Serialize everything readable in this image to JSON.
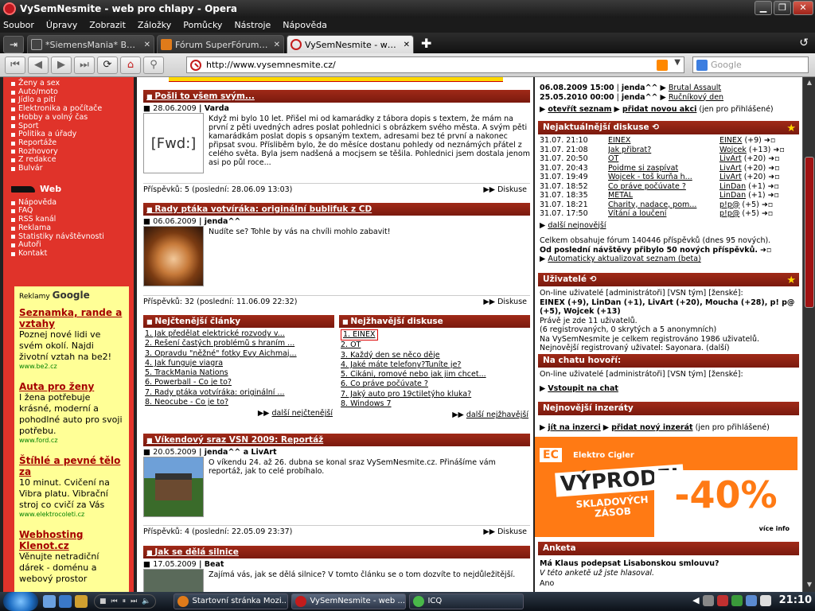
{
  "window": {
    "title": "VySemNesmite - web pro chlapy - Opera"
  },
  "menu": [
    "Soubor",
    "Úpravy",
    "Zobrazit",
    "Záložky",
    "Pomůcky",
    "Nástroje",
    "Nápověda"
  ],
  "tabs": [
    {
      "label": "*SiemensMania* Benq ~...",
      "active": false
    },
    {
      "label": "Fórum SuperFórum.cz - ...",
      "active": false
    },
    {
      "label": "VySemNesmite - web pro...",
      "active": true
    }
  ],
  "address": {
    "url": "http://www.vysemnesmite.cz/",
    "search_placeholder": "Google"
  },
  "left": {
    "menu1": [
      "Ženy a sex",
      "Auto/moto",
      "Jídlo a pití",
      "Elektronika a počítače",
      "Hobby a volný čas",
      "Sport",
      "Politika a úřady",
      "Reportáže",
      "Rozhovory",
      "Z redakce",
      "Bulvár"
    ],
    "web_title": "Web",
    "menu2": [
      "Nápověda",
      "FAQ",
      "RSS kanál",
      "Reklama",
      "Statistiky návštěvnosti",
      "Autoři",
      "Kontakt"
    ],
    "ads_label": "Reklamy",
    "ads_brand": "Google",
    "ads": [
      {
        "title": "Seznamka, rande a vztahy",
        "text": "Poznej nové lidi ve svém okolí. Najdi životní vztah na be2!",
        "url": "www.be2.cz"
      },
      {
        "title": "Auta pro ženy",
        "text": "I žena potřebuje krásné, moderní a pohodlné auto pro svoji potřebu.",
        "url": "www.ford.cz"
      },
      {
        "title": "Štíhlé a pevné tělo za",
        "text": "10 minut. Cvičení na Vibra platu. Vibrační stroj co cvičí za Vás",
        "url": "www.elektrocoleti.cz"
      },
      {
        "title": "Webhosting Klenot.cz",
        "text": "Věnujte netradiční dárek - doménu a webový prostor",
        "url": ""
      }
    ]
  },
  "articles": [
    {
      "title": "Pošli to všem svým...",
      "date": "28.06.2009",
      "author": "Varda",
      "thumb": "[Fwd:]",
      "text": "Když mi bylo 10 let. Přišel mi od kamarádky z tábora dopis s textem, že mám na první z pěti uvedných adres poslat pohlednici s obrázkem svého města. A svým pěti kamarádkám poslat dopis s opsaným textem, adresami bez té první a nakonec připsat svou. Přísliběm bylo, že do měsíce dostanu pohledy od neznámých přátel z celého světa. Byla jsem nadšená a mocjsem se těšila. Pohlednici jsem dostala jenom asi po půl roce...",
      "footer": "Příspěvků: 5 (poslední: 28.06.09 13:03)",
      "link": "Diskuse"
    },
    {
      "title": "Rady ptáka votvíráka: originální bublifuk z CD",
      "date": "06.06.2009",
      "author": "jenda^^",
      "text": "Nudíte se? Tohle by vás na chvíli mohlo zabavit!",
      "footer": "Příspěvků: 32 (poslední: 11.06.09 22:32)",
      "link": "Diskuse"
    },
    {
      "title": "Víkendový sraz VSN 2009: Reportáž",
      "date": "20.05.2009",
      "author": "jenda^^ a LivArt",
      "text": "O víkendu 24. až 26. dubna se konal sraz VySemNesmite.cz. Přinášíme vám reportáž, jak to celé probíhalo.",
      "footer": "Příspěvků: 4 (poslední: 22.05.09 23:37)",
      "link": "Diskuse"
    },
    {
      "title": "Jak se dělá silnice",
      "date": "17.05.2009",
      "author": "Beat",
      "text": "Zajímá vás, jak se dělá silnice? V tomto článku se o tom dozvíte to nejdůležitější."
    }
  ],
  "most_read": {
    "title": "Nejčtenější články",
    "items": [
      "1. Jak předělat elektrické rozvody v...",
      "2. Řešení častých problémů s hraním ...",
      "3. Opravdu \"něžné\" fotky Evy Aichmaj...",
      "4. Jak funguje viagra",
      "5. TrackMania Nations",
      "6. Powerball - Co je to?",
      "7. Rady ptáka votvíráka: originální ...",
      "8. Neocube - Co je to?"
    ],
    "more": "další nejčtenější"
  },
  "hottest": {
    "title": "Nejžhavější diskuse",
    "items": [
      "1. EINEX",
      "2. OT",
      "3. Každý den se něco děje",
      "4. Jaké máte telefony?Tuníte je?",
      "5. Cikáni, romové nebo jak jim chcet...",
      "6. Čo práve počúvate ?",
      "7. Jaký auto pro 19ctiletýho kluka?",
      "8. Windows 7"
    ],
    "more": "další nejžhavější"
  },
  "right": {
    "events": [
      {
        "date": "06.08.2009 15:00",
        "author": "jenda^^",
        "title": "Brutal Assault"
      },
      {
        "date": "25.05.2010 00:00",
        "author": "jenda^^",
        "title": "Ručníkový den"
      }
    ],
    "events_open": "otevřít seznam",
    "events_add": "přidat novou akci",
    "events_add_note": "(jen pro přihlášené)",
    "disc_title": "Nejaktuálnější diskuse",
    "discussions": [
      {
        "dt": "31.07. 21:10",
        "title": "EINEX",
        "author": "EINEX",
        "score": "(+9)"
      },
      {
        "dt": "31.07. 21:08",
        "title": "Jak přibrat?",
        "author": "Wojcek",
        "score": "(+13)"
      },
      {
        "dt": "31.07. 20:50",
        "title": "OT",
        "author": "LivArt",
        "score": "(+20)"
      },
      {
        "dt": "31.07. 20:43",
        "title": "Poidme si zaspívat",
        "author": "LivArt",
        "score": "(+20)"
      },
      {
        "dt": "31.07. 19:49",
        "title": "Wojcek - toš kurňa h...",
        "author": "LivArt",
        "score": "(+20)"
      },
      {
        "dt": "31.07. 18:52",
        "title": "Čo práve počúvate ?",
        "author": "LinDan",
        "score": "(+1)"
      },
      {
        "dt": "31.07. 18:35",
        "title": "METAL",
        "author": "LinDan",
        "score": "(+1)"
      },
      {
        "dt": "31.07. 18:21",
        "title": "Charity, nadace, pom...",
        "author": "p!p@",
        "score": "(+5)"
      },
      {
        "dt": "31.07. 17:50",
        "title": "Vítání a loučení",
        "author": "p!p@",
        "score": "(+5)"
      }
    ],
    "disc_more": "další nejnovější",
    "forum_stats": "Celkem obsahuje fórum 140446 příspěvků (dnes 95 nových).",
    "forum_stats2": "Od poslední návštěvy přibylo 50 nových příspěvků.",
    "auto_update": "Automaticky aktualizovat seznam (beta)",
    "users_title": "Uživatelé",
    "users_online": "On-line uživatelé [administrátoři] [VSN tým] [ženské]:",
    "users_list": "EINEX (+9), LinDan (+1), LivArt (+20), Moucha (+28), p! p@ (+5), Wojcek (+13)",
    "users_now": "Právě je zde 11 uživatelů.",
    "users_detail": "(6 registrovaných, 0 skrytých a 5 anonymních)",
    "users_total": "Na VySemNesmite je celkem registrováno 1986 uživatelů.",
    "users_newest": "Nejnovější registrovaný uživatel: Sayonara. (další)",
    "chat_title": "Na chatu hovoří:",
    "chat_online": "On-line uživatelé [administrátoři] [VSN tým] [ženské]:",
    "chat_enter": "Vstoupit na chat",
    "ads_title": "Nejnovější inzeráty",
    "ads_goto": "jít na inzerci",
    "ads_add": "přidat nový inzerát",
    "ads_note": "(jen pro přihlášené)",
    "banner": {
      "ec": "EC",
      "brand": "Elektro Cigler",
      "big": "VÝPRODEJ",
      "sub1": "SKLADOVÝCH",
      "sub2": "ZÁSOB",
      "pct": "-40%",
      "info": "více info"
    },
    "poll_title": "Anketa",
    "poll_q": "Má Klaus podepsat Lisabonskou smlouvu?",
    "poll_note": "V této anketě už jste hlasoval.",
    "poll_ans": "Ano"
  },
  "taskbar": {
    "tasks": [
      "Startovní stránka Mozi...",
      "VySemNesmite - web ...",
      "ICQ"
    ],
    "clock": "21:10"
  }
}
